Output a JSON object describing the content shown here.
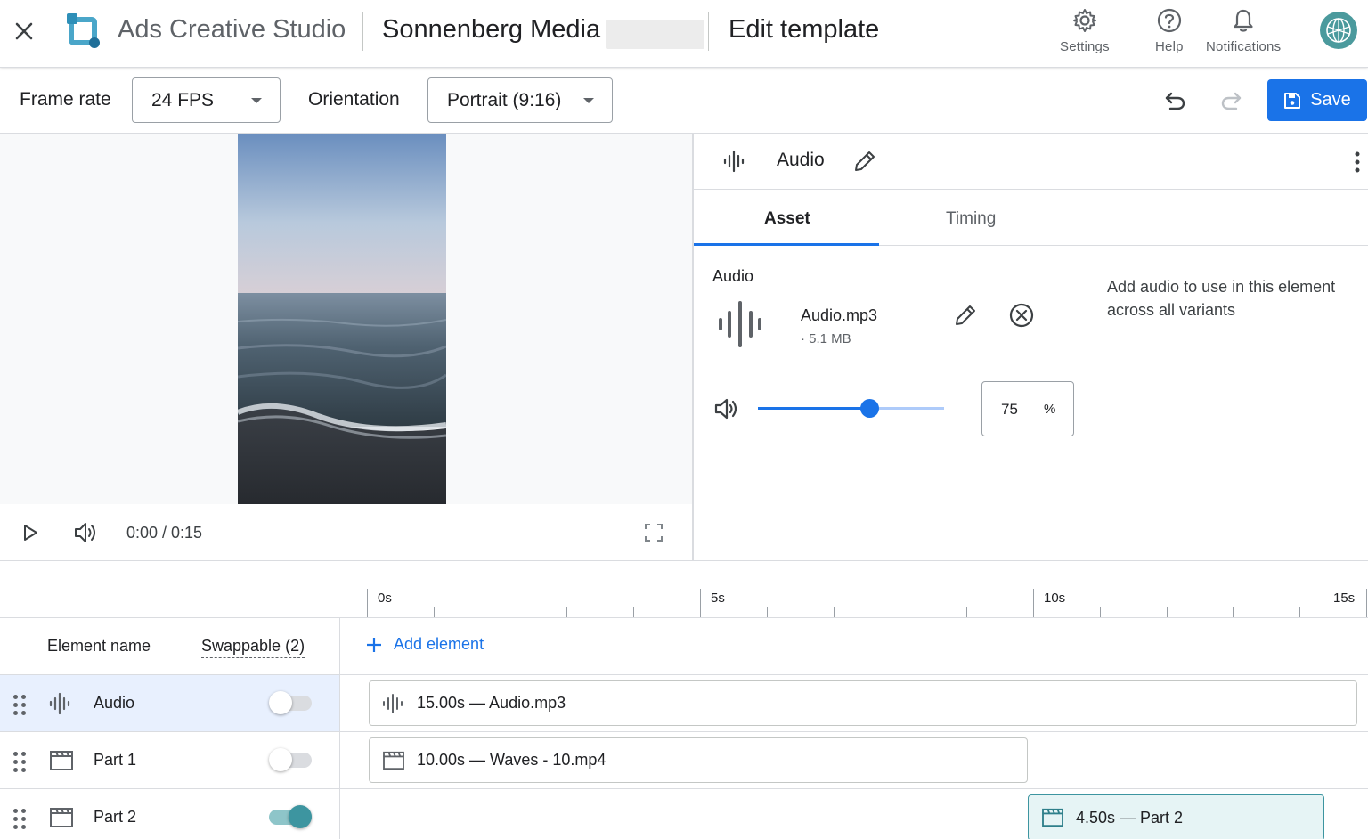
{
  "header": {
    "app_title": "Ads Creative Studio",
    "account_name": "Sonnenberg Media",
    "page_title": "Edit template",
    "actions": [
      {
        "label": "Settings",
        "icon": "gear-icon"
      },
      {
        "label": "Help",
        "icon": "help-icon"
      },
      {
        "label": "Notifications",
        "icon": "bell-icon"
      }
    ]
  },
  "toolbar": {
    "frame_rate_label": "Frame rate",
    "frame_rate_value": "24 FPS",
    "orientation_label": "Orientation",
    "orientation_value": "Portrait (9:16)",
    "save_label": "Save"
  },
  "player": {
    "time": "0:00 / 0:15"
  },
  "panel": {
    "title": "Audio",
    "tabs": [
      {
        "label": "Asset",
        "active": true
      },
      {
        "label": "Timing",
        "active": false
      }
    ],
    "section_label": "Audio",
    "file_name": "Audio.mp3",
    "file_size": "· 5.1 MB",
    "help_text": "Add audio to use in this element across all variants",
    "volume_value": "75",
    "volume_unit": "%",
    "volume_fraction": 0.6
  },
  "timeline": {
    "ticks": [
      "0s",
      "5s",
      "10s",
      "15s"
    ],
    "element_name_header": "Element name",
    "swappable_header": "Swappable (2)",
    "add_element_label": "Add element",
    "rows": [
      {
        "name": "Audio",
        "swappable": false,
        "clip": "15.00s — Audio.mp3"
      },
      {
        "name": "Part 1",
        "swappable": false,
        "clip": "10.00s — Waves - 10.mp4"
      },
      {
        "name": "Part 2",
        "swappable": true,
        "clip": "4.50s — Part 2"
      }
    ]
  },
  "colors": {
    "accent": "#1a73e8",
    "toggle_on": "#4b9fa5",
    "selected_row": "#e8f0fe",
    "selected_clip": "#e6f4f5"
  }
}
